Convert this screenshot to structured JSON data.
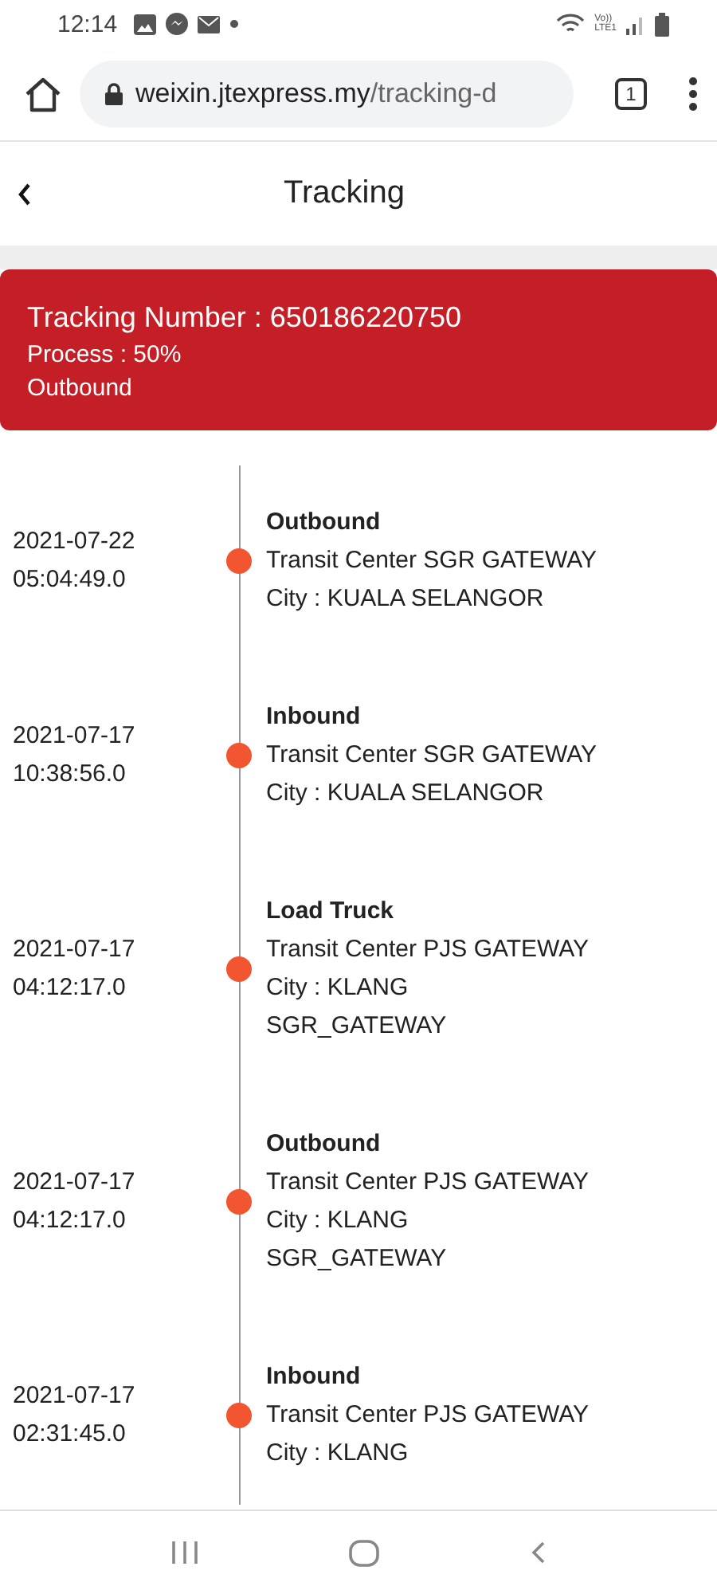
{
  "status_bar": {
    "time": "12:14",
    "network_top": "Vo))",
    "network_bottom": "LTE1"
  },
  "browser": {
    "url_host": "weixin.jtexpress.my",
    "url_path": "/tracking-d",
    "tab_count": "1"
  },
  "header": {
    "title": "Tracking"
  },
  "summary": {
    "tracking_number": "Tracking Number : 650186220750",
    "process": "Process : 50%",
    "status": "Outbound"
  },
  "events": [
    {
      "date": "2021-07-22",
      "time": "05:04:49.0",
      "title": "Outbound",
      "lines": [
        "Transit Center SGR GATEWAY",
        "City : KUALA SELANGOR"
      ]
    },
    {
      "date": "2021-07-17",
      "time": "10:38:56.0",
      "title": "Inbound",
      "lines": [
        "Transit Center SGR GATEWAY",
        "City : KUALA SELANGOR"
      ]
    },
    {
      "date": "2021-07-17",
      "time": "04:12:17.0",
      "title": "Load Truck",
      "lines": [
        "Transit Center PJS GATEWAY",
        "City : KLANG",
        "SGR_GATEWAY"
      ]
    },
    {
      "date": "2021-07-17",
      "time": "04:12:17.0",
      "title": "Outbound",
      "lines": [
        "Transit Center PJS GATEWAY",
        "City : KLANG",
        "SGR_GATEWAY"
      ]
    },
    {
      "date": "2021-07-17",
      "time": "02:31:45.0",
      "title": "Inbound",
      "lines": [
        "Transit Center PJS GATEWAY",
        "City : KLANG"
      ]
    }
  ]
}
